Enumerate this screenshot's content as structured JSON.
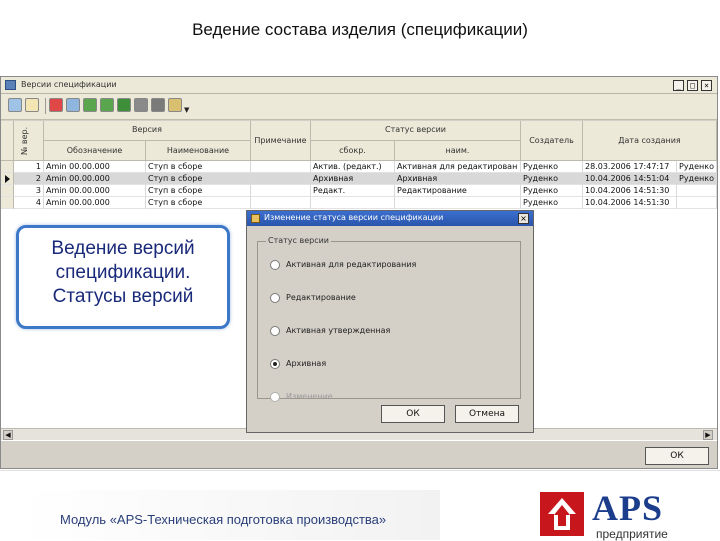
{
  "slide": {
    "title": "Ведение  состава изделия (спецификации)",
    "footer": "Модуль «APS-Техническая подготовка производства»",
    "logo_text": "APS",
    "logo_subtitle": "предприятие"
  },
  "window": {
    "title": "Версии спецификации",
    "ok_label": "ОК"
  },
  "grid": {
    "header_num": "№ вер.",
    "group_version": "Версия",
    "group_status": "Статус версии",
    "col_designation": "Обозначение",
    "col_name": "Наименование",
    "col_note": "Примечание",
    "col_abbr": "сбокр.",
    "col_status_name": "наим.",
    "col_creator": "Создатель",
    "col_created": "Дата создания",
    "rows": [
      {
        "num": "1",
        "designation": "Amin 00.00.000",
        "name": "Ступ в сборе",
        "note": "",
        "abbr": "Актив. (редакт.)",
        "status": "Активная для редактирован",
        "creator": "Руденко",
        "created": "28.03.2006 17:47:17",
        "extra": "Руденко"
      },
      {
        "num": "2",
        "designation": "Amin 00.00.000",
        "name": "Ступ в сборе",
        "note": "",
        "abbr": "Архивная",
        "status": "Архивная",
        "creator": "Руденко",
        "created": "10.04.2006 14:51:04",
        "extra": "Руденко"
      },
      {
        "num": "3",
        "designation": "Amin 00.00.000",
        "name": "Ступ в сборе",
        "note": "",
        "abbr": "Редакт.",
        "status": "Редактирование",
        "creator": "Руденко",
        "created": "10.04.2006 14:51:30",
        "extra": ""
      },
      {
        "num": "4",
        "designation": "Amin 00.00.000",
        "name": "Ступ в сборе",
        "note": "",
        "abbr": "",
        "status": "",
        "creator": "Руденко",
        "created": "10.04.2006 14:51:30",
        "extra": ""
      }
    ]
  },
  "callout": {
    "line1": "Ведение версий",
    "line2": "спецификации.",
    "line3": "Статусы версий"
  },
  "dialog": {
    "title": "Изменение статуса версии спецификации",
    "group_label": "Статус версии",
    "options": [
      {
        "label": "Активная для редактирования",
        "checked": false,
        "disabled": false
      },
      {
        "label": "Редактирование",
        "checked": false,
        "disabled": false
      },
      {
        "label": "Активная утвержденная",
        "checked": false,
        "disabled": false
      },
      {
        "label": "Архивная",
        "checked": true,
        "disabled": false
      },
      {
        "label": "Изменение",
        "checked": false,
        "disabled": true
      }
    ],
    "ok_label": "ОК",
    "cancel_label": "Отмена"
  },
  "colors": {
    "callout_border": "#3d78c8",
    "callout_text": "#1a2a7a",
    "logo_red": "#c8161d",
    "logo_blue": "#1c3d8c",
    "dialog_title_bg": "#2a55aa"
  }
}
